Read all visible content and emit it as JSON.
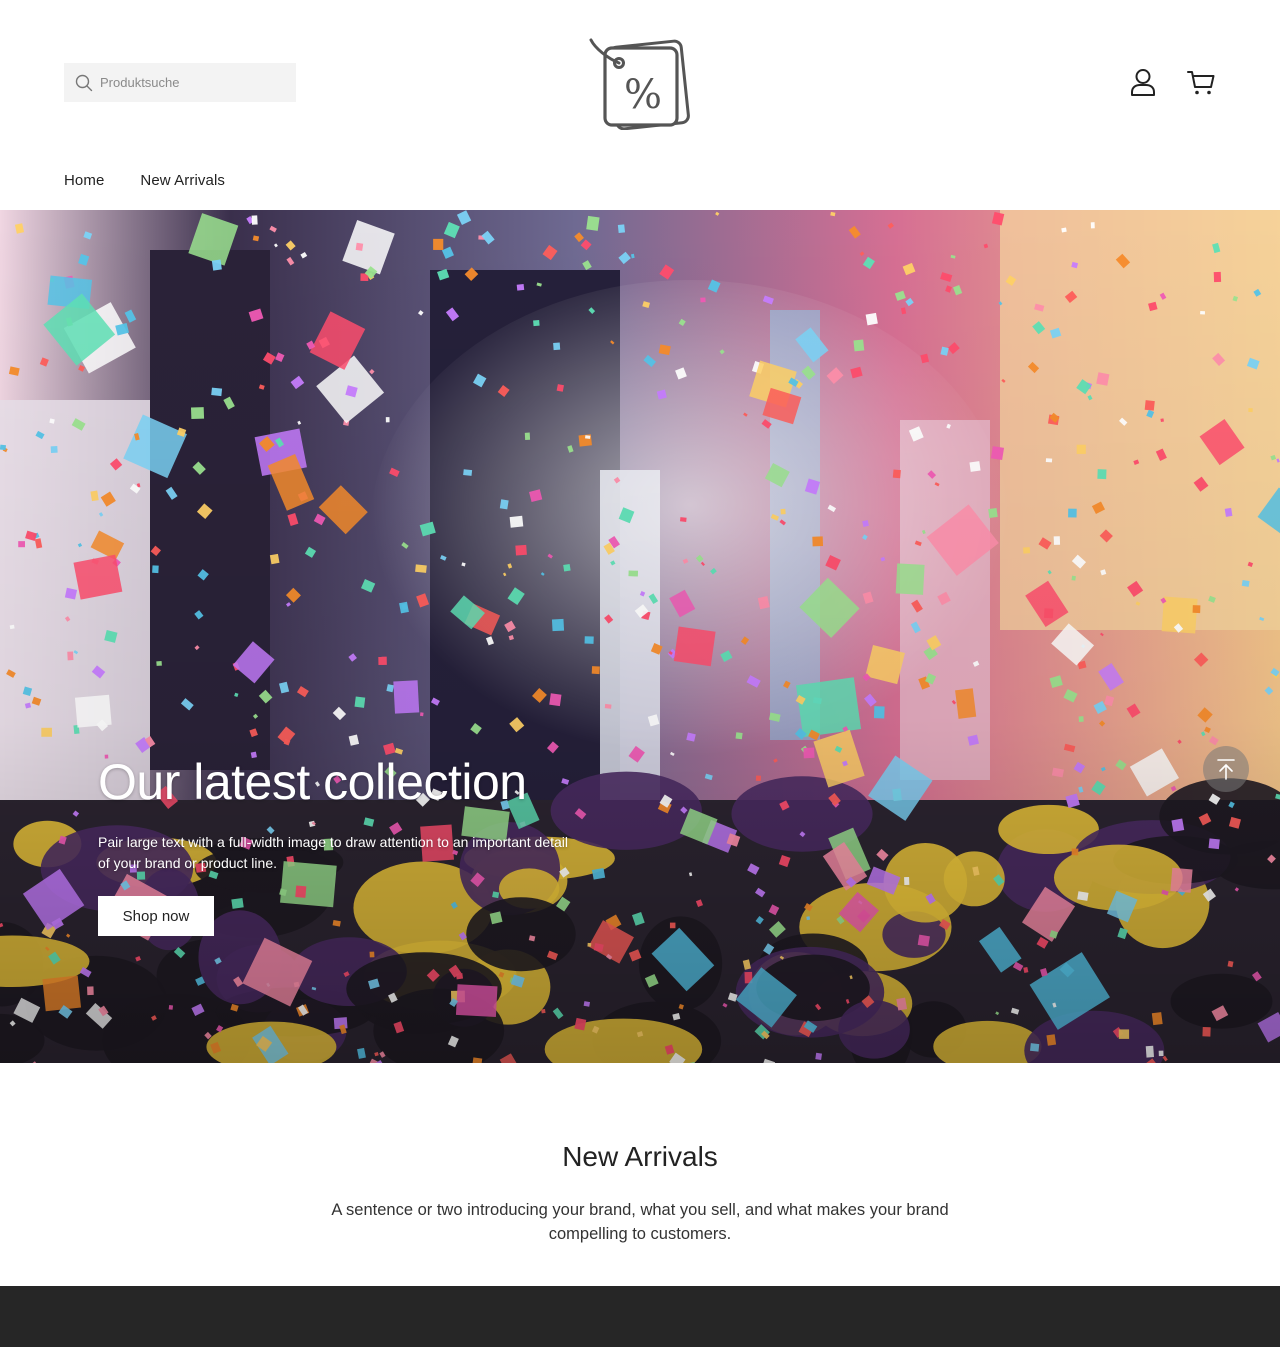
{
  "header": {
    "search": {
      "placeholder": "Produktsuche",
      "value": ""
    },
    "logo_icon": "price-tag-percent-icon",
    "icons": [
      "user-account-icon",
      "shopping-cart-icon"
    ]
  },
  "nav": {
    "items": [
      {
        "label": "Home"
      },
      {
        "label": "New Arrivals"
      }
    ]
  },
  "hero": {
    "title": "Our latest collection",
    "text": "Pair large text with a full-width image to draw attention to an important detail of your brand or product line.",
    "button_label": "Shop now",
    "image_icon": "confetti-celebration-photo",
    "scroll_top_icon": "arrow-up-to-top-icon"
  },
  "new_arrivals": {
    "title": "New Arrivals",
    "text": "A sentence or two introducing your brand, what you sell, and what makes your brand compelling to customers."
  },
  "colors": {
    "footer_bg": "#262626",
    "search_bg": "#f3f3f3",
    "text": "#222222"
  }
}
